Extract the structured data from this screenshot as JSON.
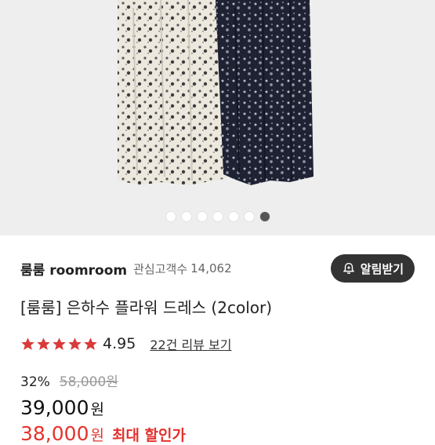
{
  "gallery": {
    "slide_count": 7,
    "active_index": 6
  },
  "shop": {
    "name": "룸룸 roomroom",
    "follower_label": "관심고객수",
    "follower_count": "14,062",
    "alert_button": "알림받기",
    "alert_icon": "bell-plus-icon"
  },
  "product": {
    "title": "[룸룸] 은하수 플라워 드레스 (2color)",
    "rating": {
      "stars": 5,
      "score": "4.95",
      "review_link": "22건 리뷰 보기",
      "star_color": "#d93a3a"
    },
    "discount_rate": "32%",
    "original_price": "58,000원",
    "price_value": "39,000",
    "price_unit": "원",
    "best_price_value": "38,000",
    "best_price_unit": "원",
    "best_price_label": "최대 할인가",
    "best_price_color": "#e5322d"
  }
}
